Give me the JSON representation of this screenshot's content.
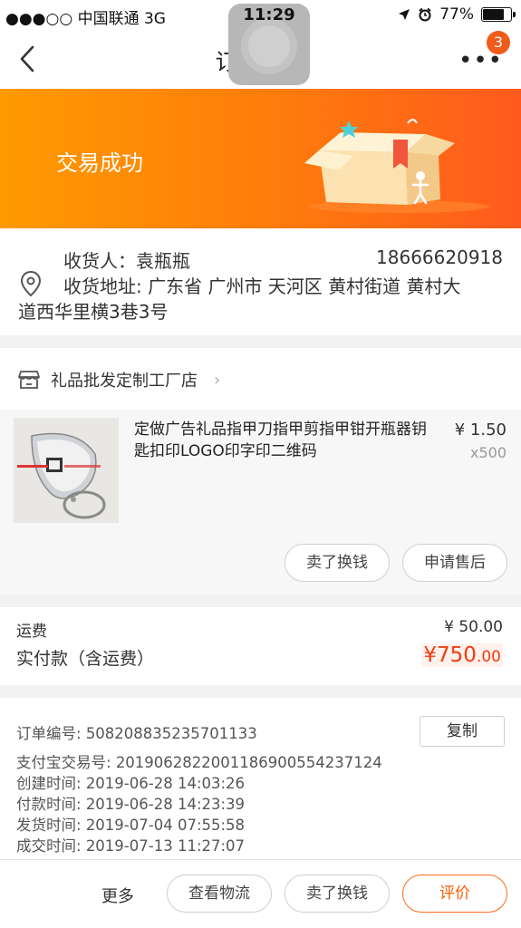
{
  "status_bar": {
    "carrier": "●●●○○ 中国联通  3G",
    "time": "11:29",
    "battery": "77%"
  },
  "nav": {
    "title": "订单详情",
    "badge_count": "3",
    "more": "•••"
  },
  "banner": {
    "status": "交易成功"
  },
  "address": {
    "recipient": "收货人：袁瓶瓶",
    "phone": "18666620918",
    "address_line1": "收货地址: 广东省 广州市 天河区    黄村街道 黄村大",
    "address_line2": "道西华里横3巷3号"
  },
  "shop": {
    "name": "礼品批发定制工厂店"
  },
  "item": {
    "title": "定做广告礼品指甲刀指甲剪指甲钳开瓶器钥匙扣印LOGO印字印二维码",
    "price": "¥ 1.50",
    "quantity": "x500",
    "btn_sell": "卖了换钱",
    "btn_aftersale": "申请售后"
  },
  "totals": {
    "shipping_label": "运费",
    "shipping_value": "¥ 50.00",
    "paid_label": "实付款（含运费）",
    "paid_int": "¥750",
    "paid_dec": ".00"
  },
  "meta": {
    "order_no_label": "订单编号:",
    "order_no": "508208835235701133",
    "copy_label": "复制",
    "alipay_label": "支付宝交易号:",
    "alipay_no": "2019062822001186900554237124",
    "created_label": "创建时间:",
    "created": "2019-06-28 14:03:26",
    "paid_time_label": "付款时间:",
    "paid_time": "2019-06-28 14:23:39",
    "shipped_label": "发货时间:",
    "shipped": "2019-07-04 07:55:58",
    "done_label": "成交时间:",
    "done": "2019-07-13 11:27:07"
  },
  "bottom": {
    "more": "更多",
    "logistics": "查看物流",
    "sell": "卖了换钱",
    "review": "评价"
  },
  "colors": {
    "accent": "#ff5a00",
    "price_red": "#f23c12",
    "banner_start": "#ff9a00",
    "banner_end": "#ff5a1e"
  }
}
